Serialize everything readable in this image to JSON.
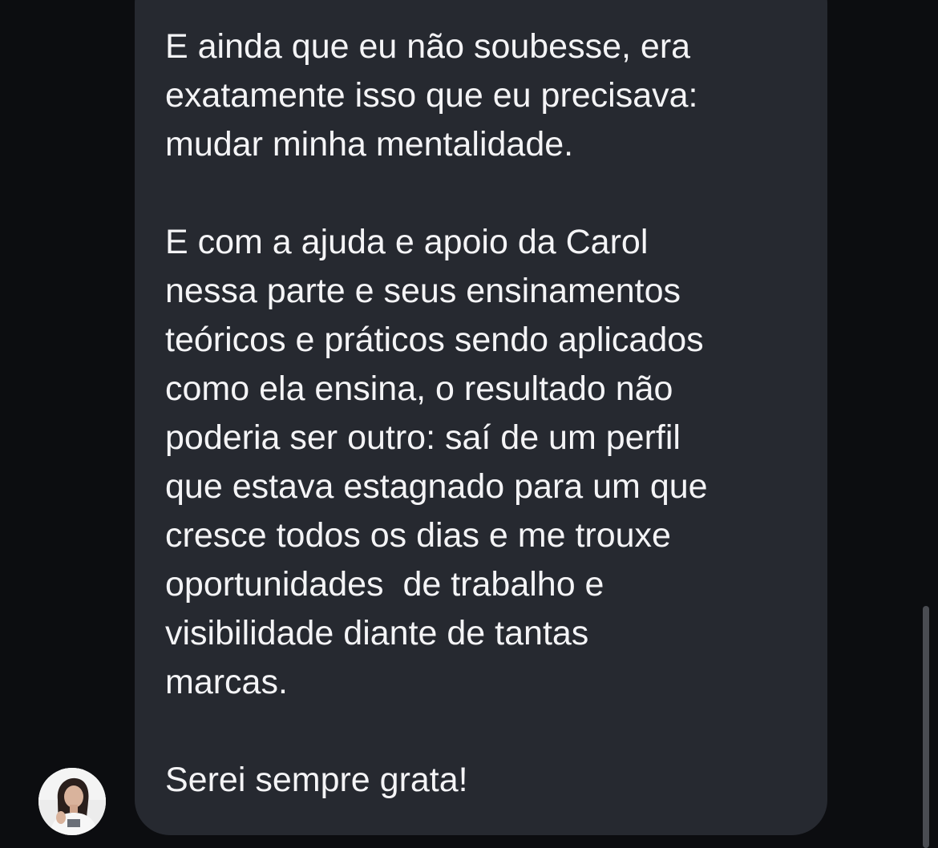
{
  "message": {
    "paragraphs": [
      {
        "lines": [
          "E ainda que eu não soubesse, era",
          "exatamente isso que eu precisava:",
          "mudar minha mentalidade."
        ]
      },
      {
        "lines": [
          "E com a ajuda e apoio da Carol",
          "nessa parte e seus ensinamentos",
          "teóricos e práticos sendo aplicados",
          "como ela ensina, o resultado não",
          "poderia ser outro: saí de um perfil",
          "que estava estagnado para um que",
          "cresce todos os dias e me trouxe",
          "oportunidades  de trabalho e",
          "visibilidade diante de tantas",
          "marcas."
        ]
      },
      {
        "lines": [
          "Serei sempre grata!"
        ]
      }
    ]
  },
  "colors": {
    "background": "#0c0d10",
    "bubble": "#262930",
    "text": "#f4f4f6",
    "scrollbar": "#4a4c52"
  },
  "icons": {
    "avatar": "sender-avatar-photo"
  }
}
